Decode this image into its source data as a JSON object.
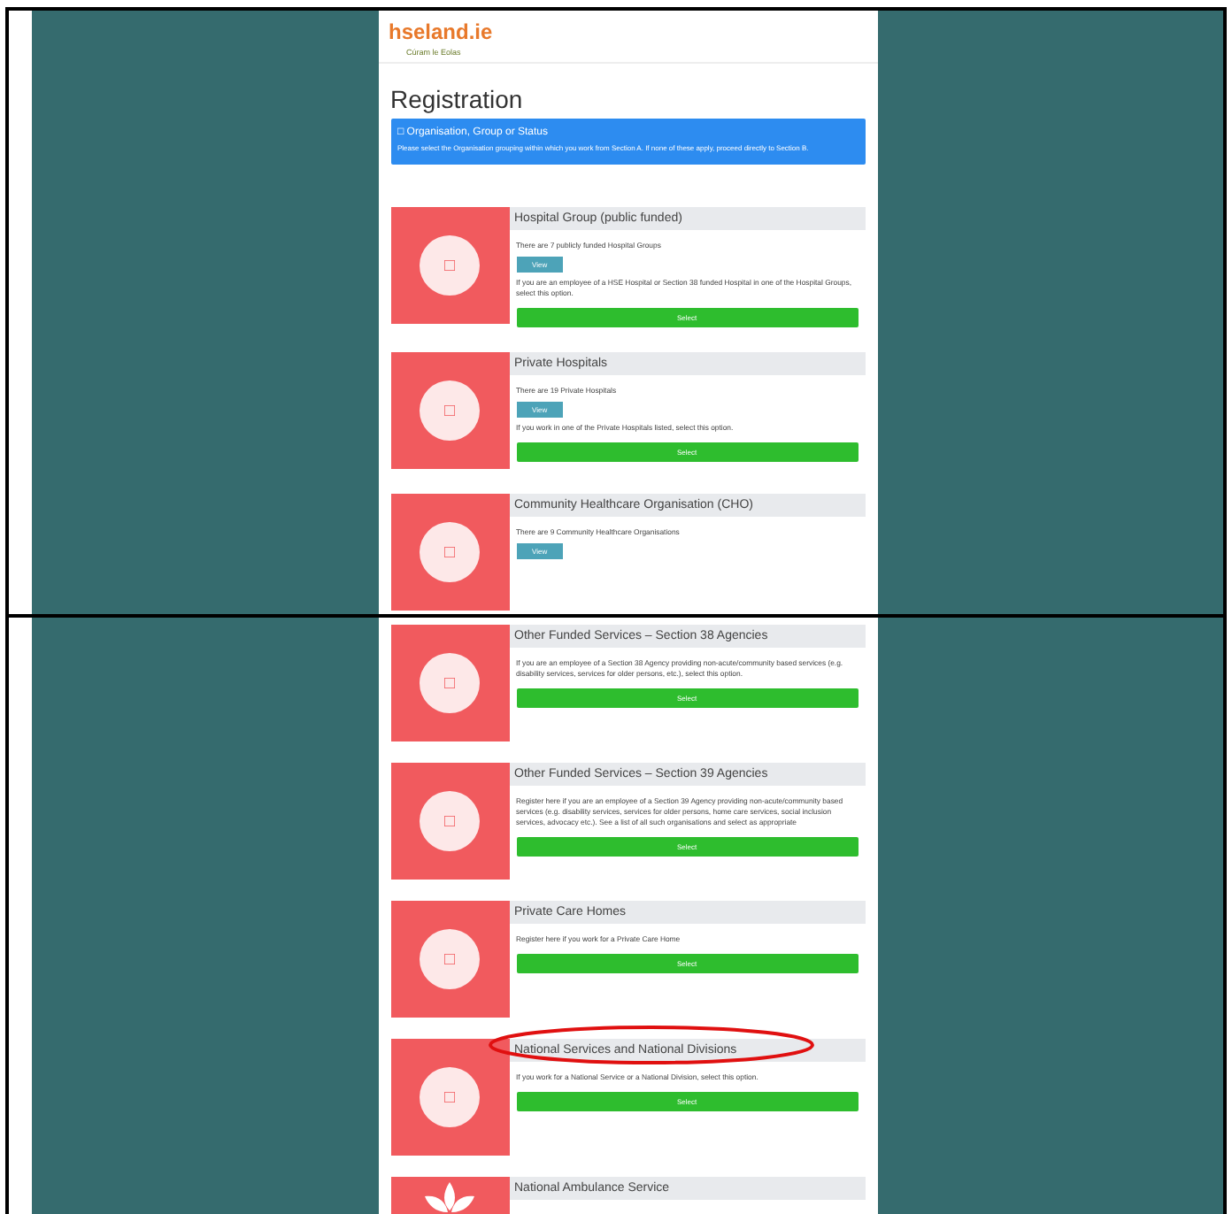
{
  "panels": [
    {
      "header": {
        "logo": "hseland.ie",
        "tagline": "Cúram le Eolas"
      },
      "title": "Registration",
      "alert": {
        "glyph": "□",
        "title": "Organisation, Group or Status",
        "text": "Please select the Organisation grouping within which you work from Section A. If none of these apply, proceed directly to Section B."
      },
      "cards": [
        {
          "icon": {
            "kind": "glyph",
            "glyph": "□"
          },
          "title": "Hospital Group (public funded)",
          "circled": false,
          "body": [
            {
              "kind": "text",
              "text": "There are 7 publicly funded Hospital Groups"
            },
            {
              "kind": "view",
              "label": "View"
            },
            {
              "kind": "text",
              "text": "If you are an employee of a HSE Hospital or Section 38 funded Hospital in one of the Hospital Groups, select this option."
            },
            {
              "kind": "select",
              "label": "Select"
            }
          ]
        },
        {
          "icon": {
            "kind": "glyph",
            "glyph": "□"
          },
          "title": "Private Hospitals",
          "circled": false,
          "body": [
            {
              "kind": "text",
              "text": "There are 19 Private Hospitals"
            },
            {
              "kind": "view",
              "label": "View"
            },
            {
              "kind": "text",
              "text": "If you work in one of the Private Hospitals listed, select this option."
            },
            {
              "kind": "select",
              "label": "Select"
            }
          ]
        },
        {
          "icon": {
            "kind": "glyph",
            "glyph": "□"
          },
          "title": "Community Healthcare Organisation (CHO)",
          "circled": false,
          "body": [
            {
              "kind": "text",
              "text": "There are 9 Community Healthcare Organisations"
            },
            {
              "kind": "view",
              "label": "View"
            }
          ]
        }
      ]
    },
    {
      "cards": [
        {
          "icon": {
            "kind": "glyph",
            "glyph": "□"
          },
          "title": "Other Funded Services – Section 38 Agencies",
          "circled": false,
          "body": [
            {
              "kind": "text",
              "text": "If you are an employee of a Section 38 Agency providing non-acute/community based services (e.g. disability services, services for older persons, etc.), select this option."
            },
            {
              "kind": "select",
              "label": "Select"
            }
          ]
        },
        {
          "icon": {
            "kind": "glyph",
            "glyph": "□"
          },
          "title": "Other Funded Services – Section 39 Agencies",
          "circled": false,
          "body": [
            {
              "kind": "text",
              "text": "Register here if you are an employee of a Section 39 Agency providing non-acute/community based services (e.g. disability services, services for older persons, home care services, social inclusion services, advocacy etc.). See a list of all such organisations and select as appropriate"
            },
            {
              "kind": "select",
              "label": "Select"
            }
          ]
        },
        {
          "icon": {
            "kind": "glyph",
            "glyph": "□"
          },
          "title": "Private Care Homes",
          "circled": false,
          "body": [
            {
              "kind": "text",
              "text": "Register here if you work for a Private Care Home"
            },
            {
              "kind": "select",
              "label": "Select"
            }
          ]
        },
        {
          "icon": {
            "kind": "glyph",
            "glyph": "□"
          },
          "title": "National Services and National Divisions",
          "circled": true,
          "body": [
            {
              "kind": "text",
              "text": "If you work for a National Service or a National Division, select this option."
            },
            {
              "kind": "select",
              "label": "Select"
            }
          ]
        },
        {
          "icon": {
            "kind": "emblem"
          },
          "title": "National Ambulance Service",
          "circled": false
        }
      ]
    }
  ]
}
